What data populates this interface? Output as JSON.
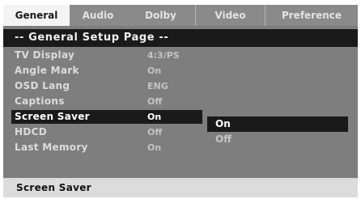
{
  "tabs": [
    {
      "label": "General",
      "active": true
    },
    {
      "label": "Audio",
      "active": false
    },
    {
      "label": "Dolby",
      "active": false
    },
    {
      "label": "Video",
      "active": false
    },
    {
      "label": "Preference",
      "active": false
    }
  ],
  "page_title": "-- General Setup Page --",
  "settings": [
    {
      "label": "TV Display",
      "value": "4:3/PS"
    },
    {
      "label": "Angle Mark",
      "value": "On"
    },
    {
      "label": "OSD Lang",
      "value": "ENG"
    },
    {
      "label": "Captions",
      "value": "Off"
    },
    {
      "label": "Screen Saver",
      "value": "On",
      "highlighted": true
    },
    {
      "label": "HDCD",
      "value": "Off"
    },
    {
      "label": "Last Memory",
      "value": "On"
    }
  ],
  "submenu": {
    "options": [
      "On",
      "Off"
    ],
    "selected": "On"
  },
  "status_text": "Screen Saver",
  "colors": {
    "panel": "#7e7e7e",
    "highlight": "#1a1a1a",
    "active_tab": "#f4f4f4",
    "status_bar": "#dcdcdc"
  }
}
